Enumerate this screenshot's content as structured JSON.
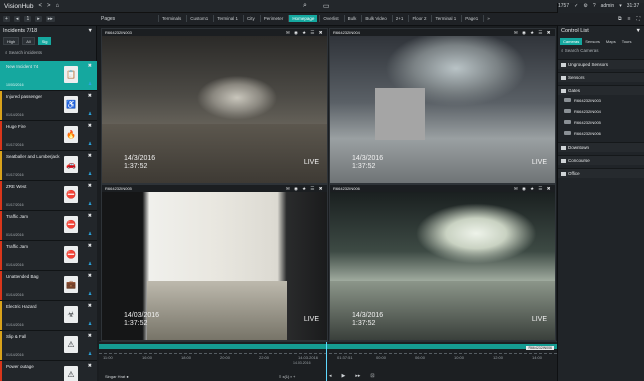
{
  "app": {
    "title": "VisionHub"
  },
  "topbar": {
    "nav": [
      "<",
      ">",
      "⌂"
    ],
    "center": [
      "⌕",
      "▭"
    ],
    "right": [
      "1757",
      "✓",
      "⚙",
      "?",
      "admin",
      "▾",
      "31:37"
    ]
  },
  "bar2": {
    "controls": [
      "+",
      "◂",
      "1",
      "▸",
      "▸▸"
    ],
    "pages_label": "Pages",
    "tabs": [
      "Terminals",
      "Custom1",
      "Terminal 1",
      "City",
      "Perimeter",
      "Homepage",
      "Overlist",
      "Bulk",
      "Bulk Video",
      "2+1",
      "Floor 2",
      "Terminal 1",
      "Page1",
      "»"
    ],
    "active_tab": 5,
    "right": [
      "⧉",
      "≡",
      "⛶"
    ]
  },
  "incidents": {
    "title": "Incidents 7/18",
    "filters": [
      "High",
      "All",
      "Sig"
    ],
    "search_placeholder": "Search incidents",
    "items": [
      {
        "name": "New Incident 74",
        "date": "10/03/2016",
        "color": "#15a89f",
        "icon": "clipboard-icon",
        "glyph": "📋",
        "active": true
      },
      {
        "name": "Injured passenger",
        "date": "01/14/2016",
        "color": "#d9a21b",
        "icon": "injury-icon",
        "glyph": "♿",
        "active": false
      },
      {
        "name": "Huge Fire",
        "date": "01/17/2016",
        "color": "#d9361b",
        "icon": "fire-icon",
        "glyph": "🔥",
        "active": false
      },
      {
        "name": "Seatballer and Lumberjack",
        "date": "01/17/2016",
        "color": "#d9a21b",
        "icon": "vehicle-icon",
        "glyph": "🚗",
        "active": false
      },
      {
        "name": "ZRE West",
        "date": "01/17/2016",
        "color": "#d9361b",
        "icon": "no-entry-icon",
        "glyph": "⛔",
        "active": false
      },
      {
        "name": "Traffic Jam",
        "date": "01/14/2016",
        "color": "#d9361b",
        "icon": "traffic-icon",
        "glyph": "⛔",
        "active": false
      },
      {
        "name": "Traffic Jam",
        "date": "01/14/2016",
        "color": "#d9361b",
        "icon": "traffic-icon",
        "glyph": "⛔",
        "active": false
      },
      {
        "name": "Unattended Bag",
        "date": "01/14/2016",
        "color": "#d9361b",
        "icon": "bag-icon",
        "glyph": "💼",
        "active": false
      },
      {
        "name": "Electric Hazard",
        "date": "01/14/2016",
        "color": "#d9a21b",
        "icon": "biohazard-icon",
        "glyph": "☣",
        "active": false
      },
      {
        "name": "Slip & Fall",
        "date": "01/14/2016",
        "color": "#d9a21b",
        "icon": "fall-icon",
        "glyph": "⚠",
        "active": false
      },
      {
        "name": "Power outage",
        "date": "",
        "color": "#d9361b",
        "icon": "warning-icon",
        "glyph": "⚠",
        "active": false
      }
    ]
  },
  "cameras": [
    {
      "id": "R664232IN003",
      "date": "14/3/2016",
      "time": "1:37:52",
      "live": "LIVE"
    },
    {
      "id": "R664232IN004",
      "date": "14/3/2016",
      "time": "1:37:52",
      "live": "LIVE"
    },
    {
      "id": "R664232IN005",
      "date": "14/03/2016",
      "time": "1:37:52",
      "live": "LIVE"
    },
    {
      "id": "R664232IN006",
      "date": "14/3/2016",
      "time": "1:37:52",
      "live": "LIVE"
    }
  ],
  "camera_controls": "✉ ◉ ★ ☰ ✖",
  "timeline": {
    "ticks": [
      "11:00",
      "16:00",
      "18:00",
      "20:00",
      "22:00",
      "14.03.2016",
      "01:37:51",
      "00:00",
      "06:00",
      "10:00",
      "12:00",
      "14:00"
    ],
    "date": "14.03.2016",
    "time": "01:37:51",
    "sub": "14.03.2016",
    "selected_label": "R664232IN006",
    "speed": "Singar  Hrat  ●",
    "zoom": "≡ x(1)  ▪ +",
    "play_controls": [
      "◂",
      "▶",
      "▸▸",
      "⊡"
    ]
  },
  "control_list": {
    "title": "Control List",
    "tabs": [
      "Cameras",
      "Sensors",
      "Maps",
      "Tours"
    ],
    "active_tab": 0,
    "search_placeholder": "Search Cameras",
    "groups": [
      {
        "label": "Ungrouped Sensors",
        "items": []
      },
      {
        "label": "Sensors",
        "items": []
      },
      {
        "label": "Gates",
        "items": [
          "R664232IN003",
          "R664232IN004",
          "R664232IN005",
          "R664232IN006"
        ]
      },
      {
        "label": "Downtown",
        "items": []
      },
      {
        "label": "Concourse",
        "items": []
      },
      {
        "label": "Office",
        "items": []
      }
    ]
  },
  "colors": {
    "accent": "#15a89f",
    "background": "#1a1d20",
    "panel": "#202428"
  }
}
